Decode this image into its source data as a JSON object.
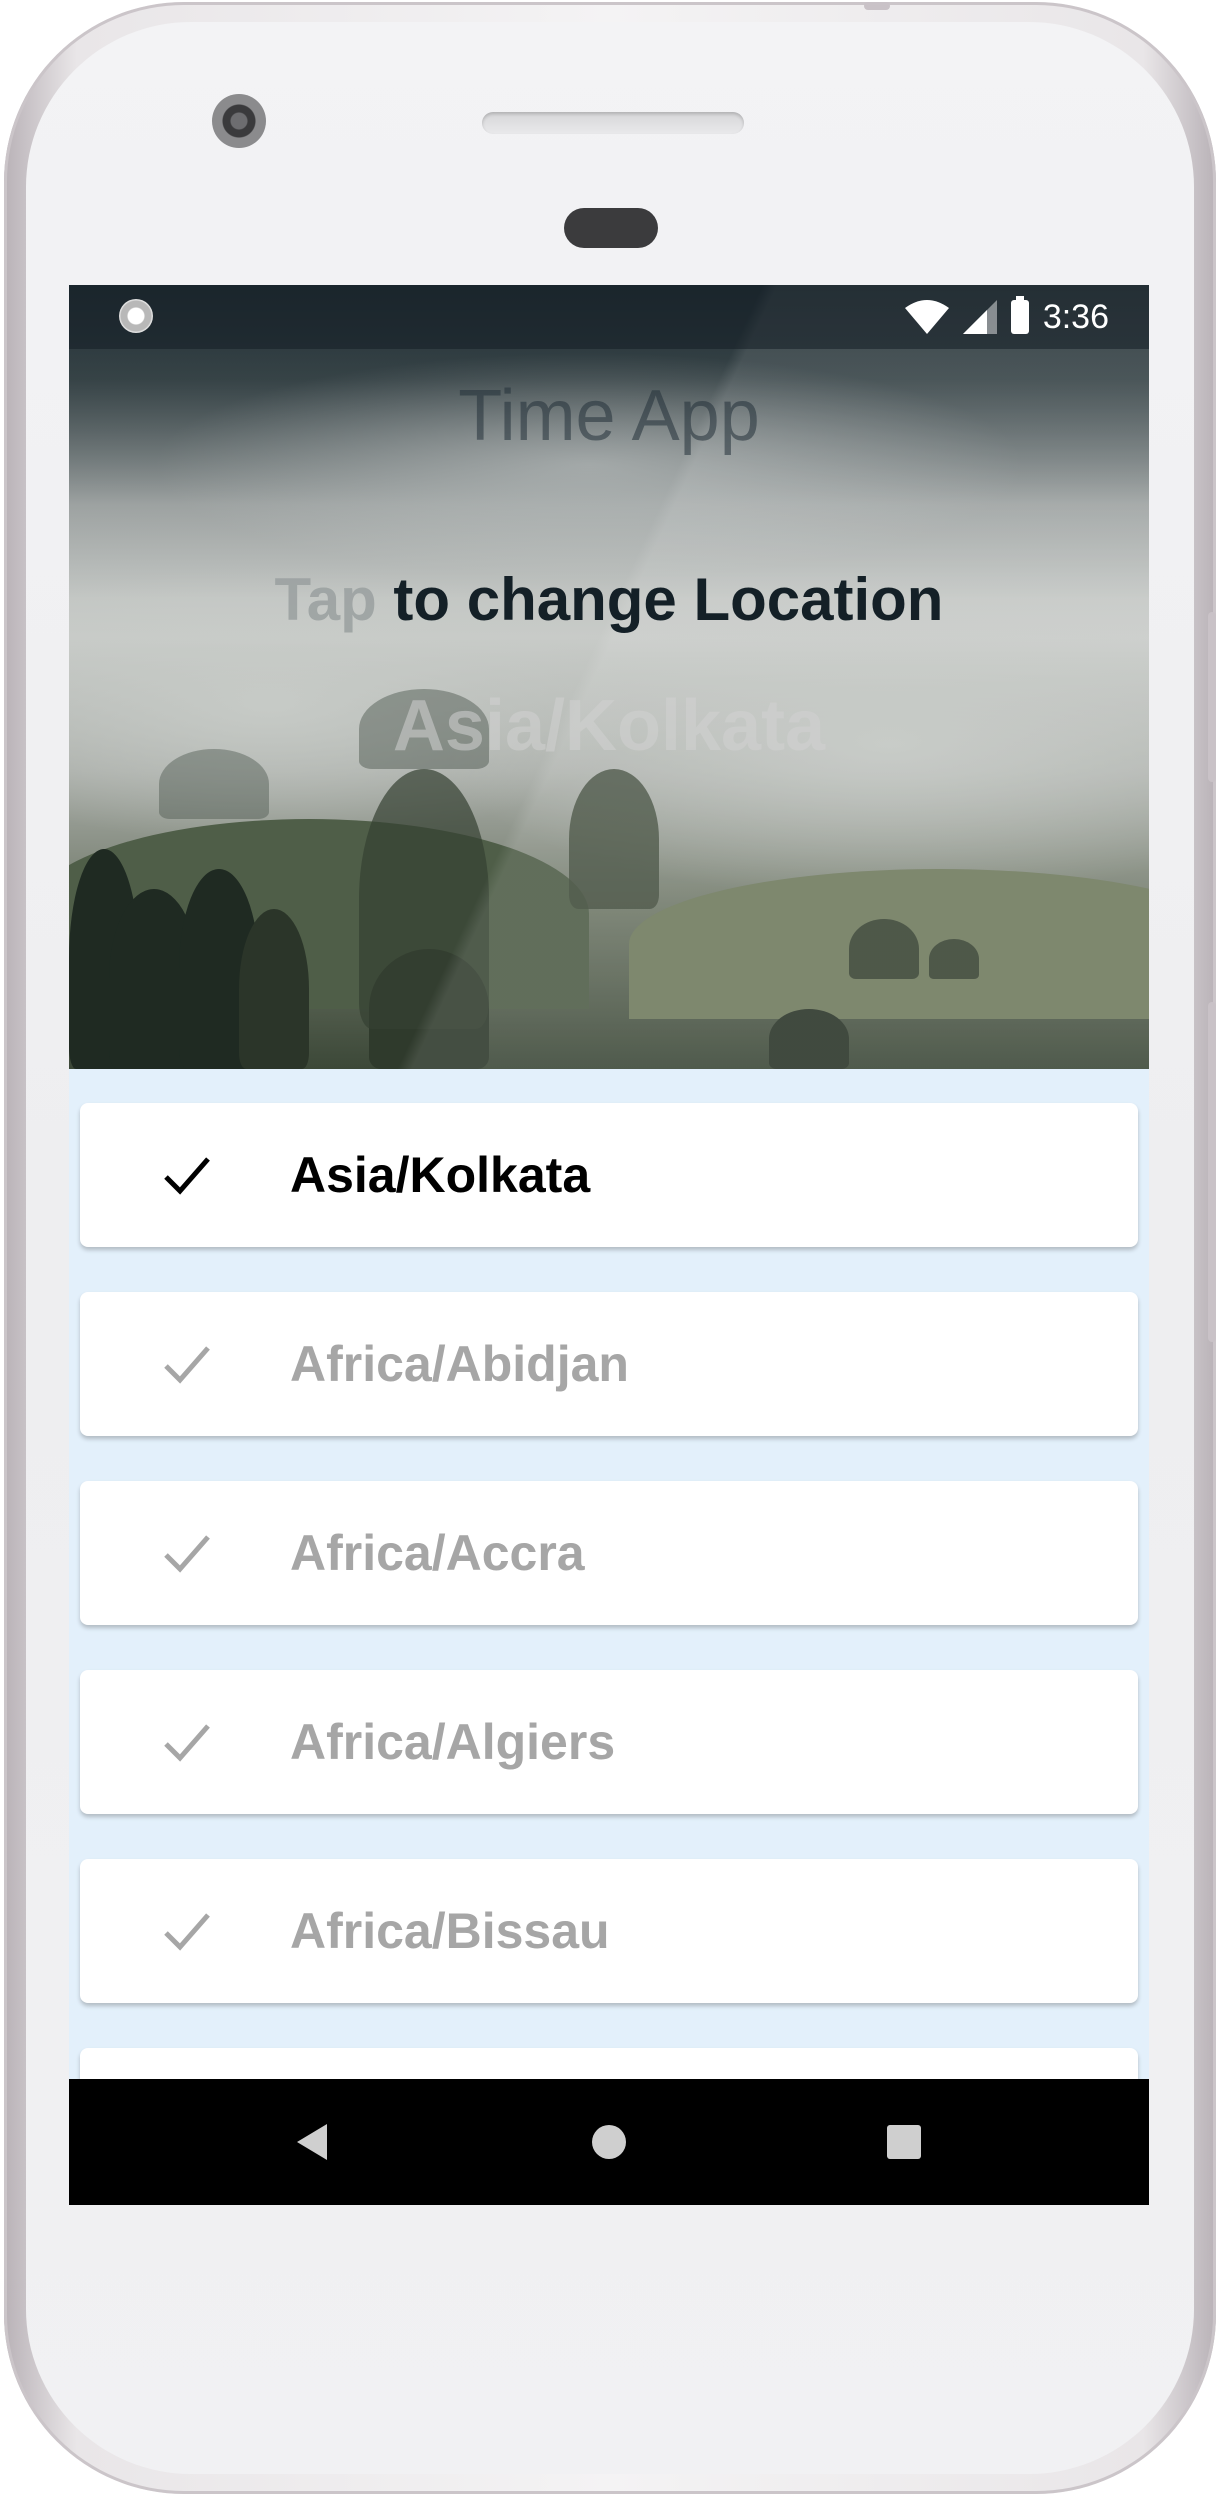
{
  "status_bar": {
    "time": "3:36",
    "icons": [
      "wifi-icon",
      "signal-icon",
      "battery-icon"
    ]
  },
  "app": {
    "title": "Time App",
    "subtitle_prefix": "Tap",
    "subtitle_rest": " to change Location",
    "current_location": "Asia/Kolkata"
  },
  "locations": [
    {
      "label": "Asia/Kolkata",
      "selected": true
    },
    {
      "label": "Africa/Abidjan",
      "selected": false
    },
    {
      "label": "Africa/Accra",
      "selected": false
    },
    {
      "label": "Africa/Algiers",
      "selected": false
    },
    {
      "label": "Africa/Bissau",
      "selected": false
    }
  ],
  "nav": [
    "back-icon",
    "home-icon",
    "recents-icon"
  ],
  "colors": {
    "list_background": "#e3f0fb",
    "selected_text": "#000000",
    "unselected_text": "#a6a6a6",
    "nav_background": "#000000"
  }
}
